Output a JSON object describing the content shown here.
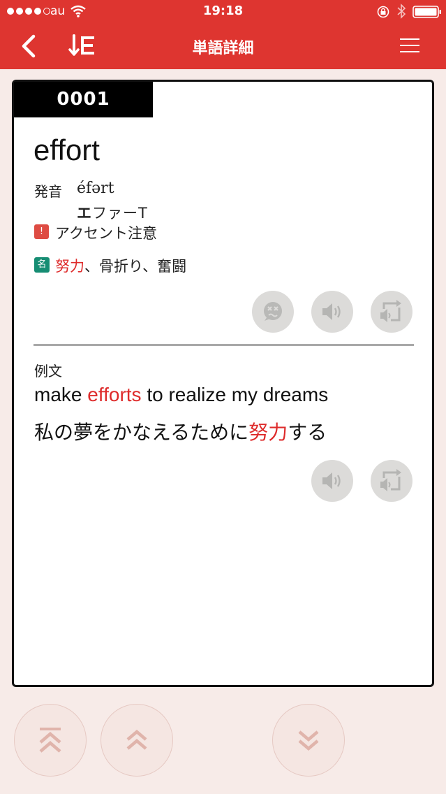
{
  "status_bar": {
    "carrier": "au",
    "time": "19:18"
  },
  "navbar": {
    "title": "単語詳細"
  },
  "card": {
    "number": "0001",
    "headword": "effort",
    "pronunciation_label": "発音",
    "ipa": "éfərt",
    "kana_bold": "エ",
    "kana_rest": "ファーT",
    "accent_warning_icon": "!",
    "accent_warning": "アクセント注意",
    "part_of_speech": "名",
    "meaning_highlight": "努力",
    "meaning_rest": "、骨折り、奮闘",
    "example_label": "例文",
    "example_en_before": "make ",
    "example_en_highlight": "efforts",
    "example_en_after": " to realize my dreams",
    "example_ja_before": "私の夢をかなえるために",
    "example_ja_highlight": "努力",
    "example_ja_after": "する",
    "word_buttons": [
      "dizzy-face-icon",
      "speaker-icon",
      "repeat-speaker-icon"
    ],
    "example_buttons": [
      "speaker-icon",
      "repeat-speaker-icon"
    ]
  },
  "bottom_nav": [
    "double-chevron-up-first-icon",
    "chevron-up-icon",
    "chevron-down-icon"
  ],
  "colors": {
    "primary_red": "#de3530",
    "highlight_red": "#de2b2b",
    "pos_green": "#168d73",
    "background": "#f7ebe8"
  }
}
